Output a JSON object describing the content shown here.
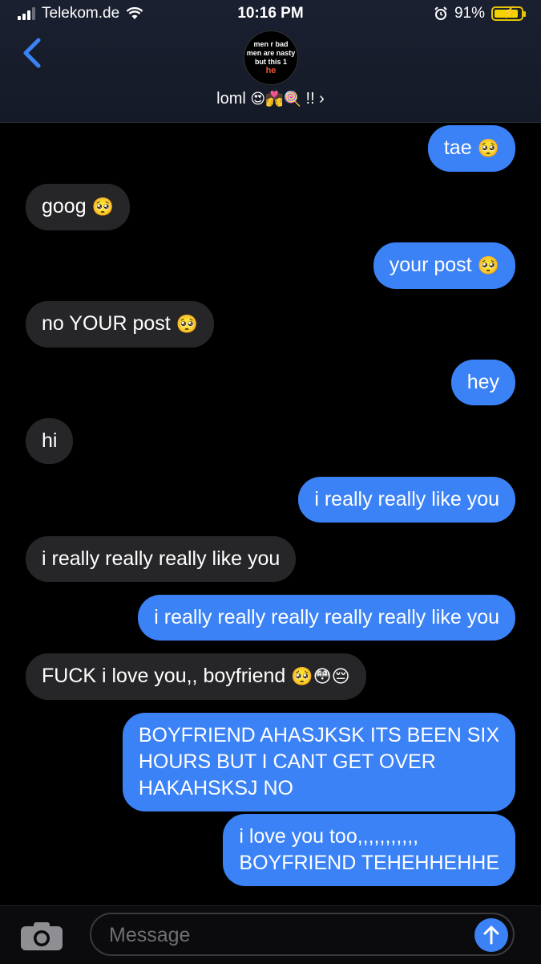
{
  "status_bar": {
    "carrier": "Telekom.de",
    "time": "10:16 PM",
    "battery": "91%",
    "battery_level": 0.91
  },
  "header": {
    "avatar_text": [
      "men r bad",
      "men are nasty",
      "but this 1"
    ],
    "avatar_he": "he",
    "contact_name": "loml",
    "contact_emojis": "😍💏🍭",
    "contact_suffix": "!! ›"
  },
  "messages": [
    {
      "side": "out",
      "text": "tae",
      "emoji": "🥺"
    },
    {
      "side": "in",
      "text": "goog",
      "emoji": "🥺"
    },
    {
      "side": "out",
      "text": "your post",
      "emoji": "🥺"
    },
    {
      "side": "in",
      "text": "no YOUR post",
      "emoji": "🥺"
    },
    {
      "side": "out",
      "text": "hey",
      "emoji": ""
    },
    {
      "side": "in",
      "text": "hi",
      "emoji": ""
    },
    {
      "side": "out",
      "text": "i really really like you",
      "emoji": ""
    },
    {
      "side": "in",
      "text": "i really really really like you",
      "emoji": ""
    },
    {
      "side": "out",
      "text": "i really really really really really like you",
      "emoji": ""
    },
    {
      "side": "in",
      "text": "FUCK i love you,, boyfriend",
      "emoji": "🥺😳😔"
    },
    {
      "side": "out",
      "text": "BOYFRIEND AHASJKSK ITS BEEN SIX HOURS BUT I CANT GET OVER HAKAHSKSJ NO",
      "lines": [
        "BOYFRIEND AHASJKSK ITS BEEN SIX",
        "HOURS BUT I CANT GET OVER",
        "HAKAHSKSJ NO"
      ],
      "emoji": ""
    },
    {
      "side": "out",
      "text": "i love you too,,,,,,,,,,, BOYFRIEND TEHEHHEHHE",
      "lines": [
        "i love you too,,,,,,,,,,,",
        "BOYFRIEND TEHEHHEHHE"
      ],
      "emoji": ""
    }
  ],
  "composer": {
    "placeholder": "Message"
  },
  "colors": {
    "outgoing": "#3b82f6",
    "incoming": "#262628",
    "background": "#000000"
  }
}
